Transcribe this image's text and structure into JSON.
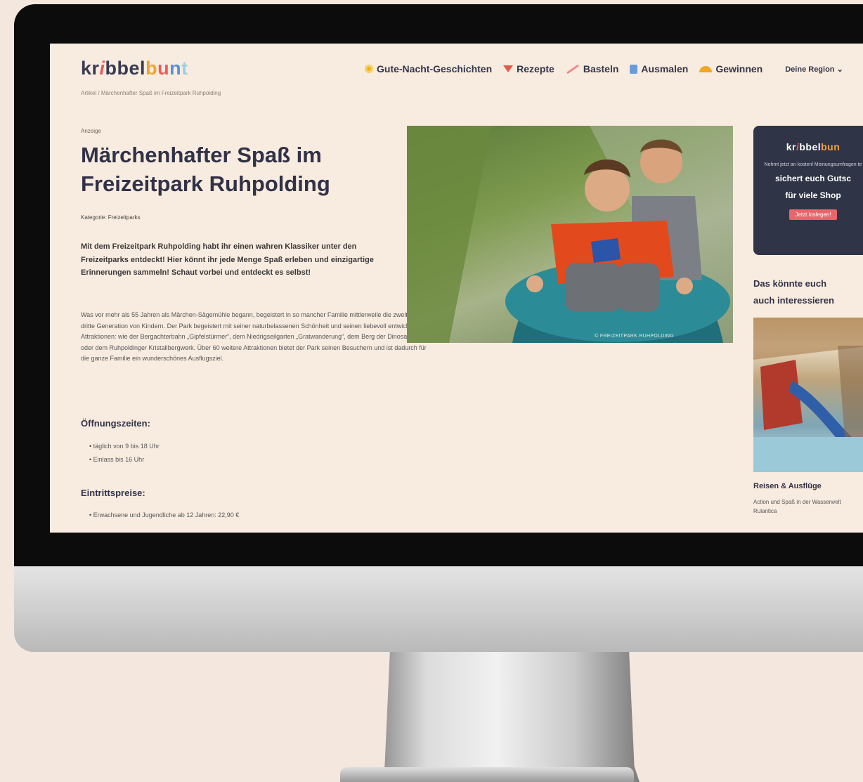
{
  "brand": {
    "logo_parts": [
      "kr",
      "i",
      "bbel",
      "b",
      "u",
      "n",
      "t"
    ]
  },
  "nav": {
    "items": [
      {
        "label": "Gute-Nacht-Geschichten",
        "icon": "sun-icon"
      },
      {
        "label": "Rezepte",
        "icon": "triangle-icon"
      },
      {
        "label": "Basteln",
        "icon": "brush-stroke-icon"
      },
      {
        "label": "Ausmalen",
        "icon": "book-icon"
      },
      {
        "label": "Gewinnen",
        "icon": "semicircle-icon"
      }
    ],
    "region": "Deine Region"
  },
  "breadcrumb": "Artikel / Märchenhafter Spaß im Freizeitpark Ruhpolding",
  "article": {
    "tag": "Anzeige",
    "title": "Märchenhafter Spaß im Freizeitpark Ruhpolding",
    "category": "Kategorie: Freizeitparks",
    "lead": "Mit dem Freizeitpark Ruhpolding habt ihr einen wahren Klassiker unter den Freizeitparks entdeckt! Hier könnt ihr jede Menge Spaß erleben und einzigartige Erinnerungen sammeln! Schaut vorbei und entdeckt es selbst!",
    "body": "Was vor mehr als 55 Jahren als Märchen-Sägemühle begann, begeistert in so mancher Familie mittlerweile die zweite oder dritte Generation von Kindern. Der Park begeistert mit seiner naturbelassenen Schönheit und seinen liebevoll entwickelten Attraktionen: wie der Bergachterbahn „Gipfelstürmer“, dem Niedrigseilgarten „Gratwanderung“, dem Berg der Dinosaurier oder dem Ruhpoldinger Kristallbergwerk. Über 60 weitere Attraktionen bietet der Park seinen Besuchern und ist dadurch für die ganze Familie ein wunderschönes Ausflugsziel.",
    "hours_heading": "Öffnungszeiten:",
    "hours": [
      "täglich von 9 bis 18 Uhr",
      "Einlass bis 16 Uhr"
    ],
    "prices_heading": "Eintrittspreise:",
    "prices": [
      "Erwachsene und Jugendliche ab 12 Jahren: 22,90 €"
    ],
    "photo_credit": "© FREIZEITPARK RUHPOLDING"
  },
  "sidebar": {
    "promo": {
      "logo_parts": [
        "kr",
        "i",
        "bbel",
        "bun"
      ],
      "text": "Nehmt jetzt an kostenl Meinungsumfragen te",
      "strong_line1": "sichert euch Gutsc",
      "strong_line2": "für viele Shop",
      "button": "Jetzt loslegen!"
    },
    "related_title": "Das könnte euch auch interessieren",
    "related_category": "Reisen & Ausflüge",
    "related_desc": "Action und Spaß in der Wasserwelt Rulantica"
  },
  "colors": {
    "page_bg": "#f8ece0",
    "text_dark": "#323247",
    "accent_red": "#e85e5e",
    "accent_orange": "#f0a532",
    "accent_blue": "#5b90d6",
    "promo_bg": "#2f3547"
  }
}
